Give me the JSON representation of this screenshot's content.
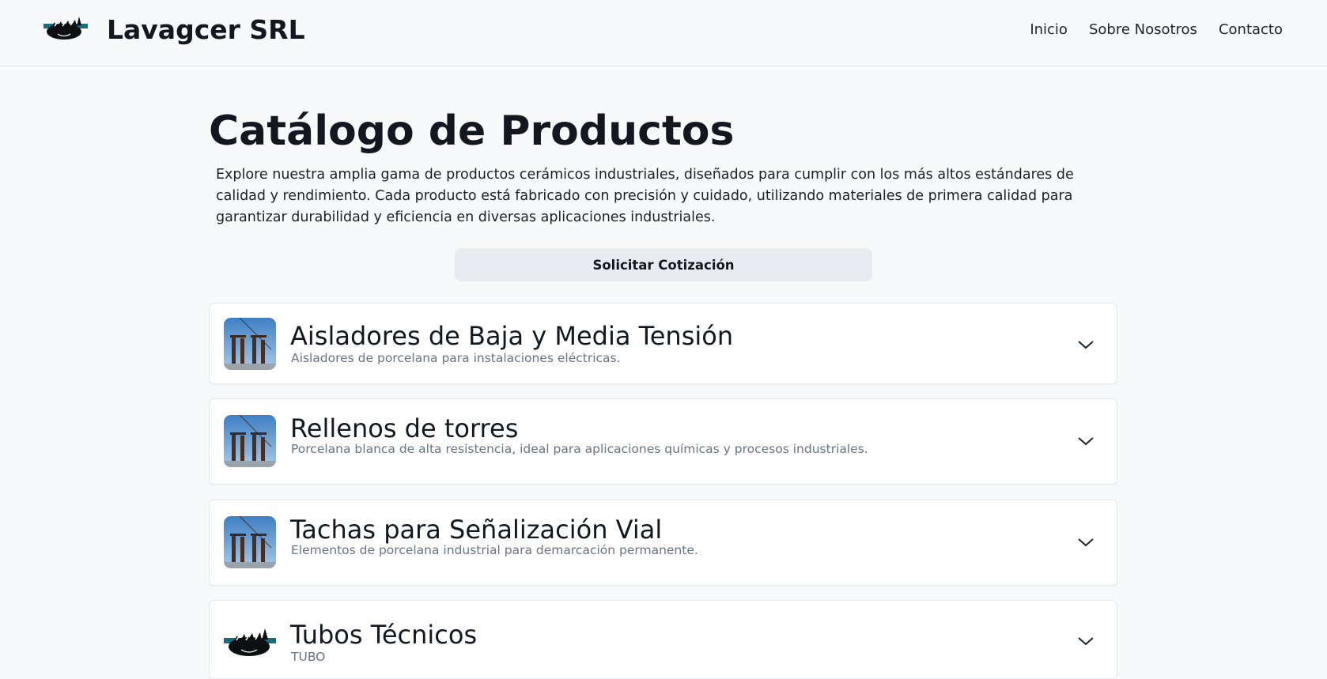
{
  "header": {
    "brand": "Lavagcer SRL",
    "logo_icon": "bird-logo-icon",
    "nav": [
      "Inicio",
      "Sobre Nosotros",
      "Contacto"
    ]
  },
  "main": {
    "title": "Catálogo de Productos",
    "intro": "Explore nuestra amplia gama de productos cerámicos industriales, diseñados para cumplir con los más altos estándares de calidad y rendimiento. Cada producto está fabricado con precisión y cuidado, utilizando materiales de primera calidad para garantizar durabilidad y eficiencia en diversas aplicaciones industriales.",
    "quote_button": "Solicitar Cotización"
  },
  "products": [
    {
      "title": "Aisladores de Baja y Media Tensión",
      "subtitle": "Aisladores de porcelana para instalaciones eléctricas.",
      "thumb": "substation-photo"
    },
    {
      "title": "Rellenos de torres",
      "subtitle": "Porcelana blanca de alta resistencia, ideal para aplicaciones químicas y procesos industriales.",
      "thumb": "substation-photo"
    },
    {
      "title": "Tachas para Señalización Vial",
      "subtitle": "Elementos de porcelana industrial para demarcación permanente.",
      "thumb": "substation-photo"
    },
    {
      "title": "Tubos Técnicos",
      "subtitle": "TUBO",
      "thumb": "bird-logo"
    }
  ],
  "colors": {
    "background": "#f8f9fb",
    "button": "#e8ebf0",
    "logo_teal": "#1c6a80",
    "text": "#131820",
    "muted": "#6b7380"
  }
}
